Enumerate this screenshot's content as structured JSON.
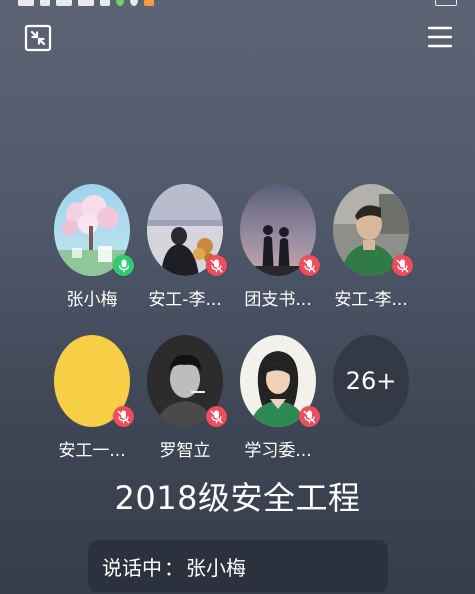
{
  "header": {
    "minimize_icon": "minimize-arrows-icon",
    "menu_icon": "hamburger-menu-icon"
  },
  "participants": [
    {
      "name": "张小梅",
      "mic": "active",
      "avatar": "sakura-tree-photo"
    },
    {
      "name": "安工-李...",
      "mic": "muted",
      "avatar": "seaside-person-photo"
    },
    {
      "name": "团支书...",
      "mic": "muted",
      "avatar": "silhouette-girls-photo"
    },
    {
      "name": "安工-李...",
      "mic": "muted",
      "avatar": "man-portrait-photo"
    },
    {
      "name": "安工一...",
      "mic": "muted",
      "avatar": "yellow-circle"
    },
    {
      "name": "罗智立",
      "mic": "muted",
      "avatar": "bw-man-smoking-photo"
    },
    {
      "name": "学习委...",
      "mic": "muted",
      "avatar": "illustrated-woman"
    }
  ],
  "more": {
    "label": "26+"
  },
  "group_title": "2018级安全工程",
  "speaking": {
    "prefix": "说话中",
    "colon": "：",
    "name": "张小梅"
  },
  "colors": {
    "mic_active": "#2ecc71",
    "mic_muted": "#ee4d5e",
    "banner_bg": "#2c323d"
  }
}
